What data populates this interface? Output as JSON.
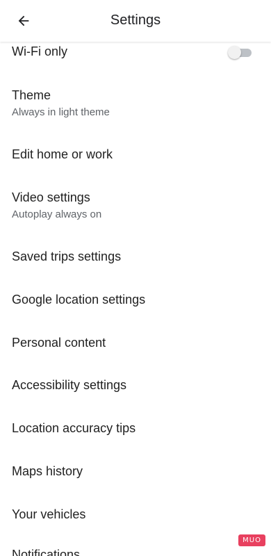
{
  "header": {
    "title": "Settings",
    "back_icon": "arrow-back-icon"
  },
  "settings": {
    "wifi_only": {
      "label": "Wi-Fi only",
      "toggle_state": "off"
    },
    "theme": {
      "label": "Theme",
      "sub": "Always in light theme"
    },
    "edit_home": {
      "label": "Edit home or work"
    },
    "video": {
      "label": "Video settings",
      "sub": "Autoplay always on"
    },
    "saved_trips": {
      "label": "Saved trips settings"
    },
    "google_location": {
      "label": "Google location settings"
    },
    "personal_content": {
      "label": "Personal content"
    },
    "accessibility": {
      "label": "Accessibility settings"
    },
    "location_accuracy": {
      "label": "Location accuracy tips"
    },
    "maps_history": {
      "label": "Maps history"
    },
    "your_vehicles": {
      "label": "Your vehicles"
    },
    "notifications": {
      "label": "Notifications"
    }
  },
  "watermark": "MUO",
  "colors": {
    "text_primary": "#1f1f1f",
    "text_secondary": "#5f6368",
    "toggle_track": "#bdc1c6",
    "watermark_bg": "#e8405f"
  }
}
